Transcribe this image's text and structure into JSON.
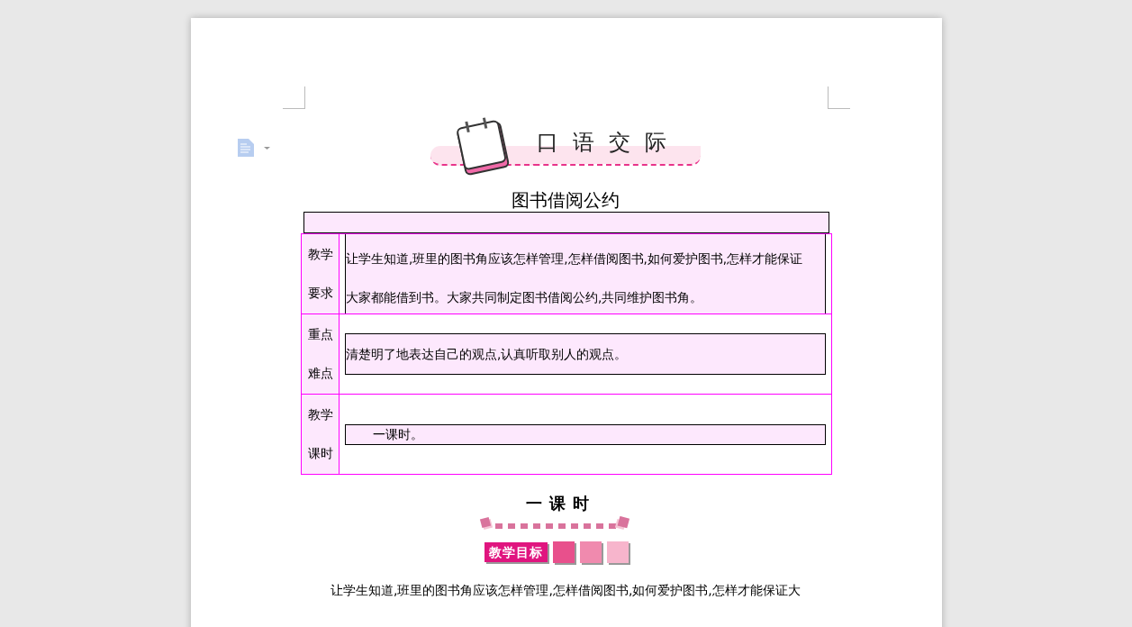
{
  "header": {
    "title": "口语交际"
  },
  "doc_title": "图书借阅公约",
  "table": {
    "rows": [
      {
        "label_lines": [
          "教学",
          "要求"
        ],
        "content_lines": [
          "让学生知道,班里的图书角应该怎样管理,怎样借阅图书,如何爱护图书,怎样才能保证",
          "大家都能借到书。大家共同制定图书借阅公约,共同维护图书角。"
        ]
      },
      {
        "label_lines": [
          "重点",
          "难点"
        ],
        "content_lines": [
          "清楚明了地表达自己的观点,认真听取别人的观点。"
        ]
      },
      {
        "label_lines": [
          "教学",
          "课时"
        ],
        "content_lines": [
          "一课时。"
        ]
      }
    ]
  },
  "section": {
    "title": "一课时",
    "badge": "教学目标"
  },
  "paragraph": "让学生知道,班里的图书角应该怎样管理,怎样借阅图书,如何爱护图书,怎样才能保证大"
}
